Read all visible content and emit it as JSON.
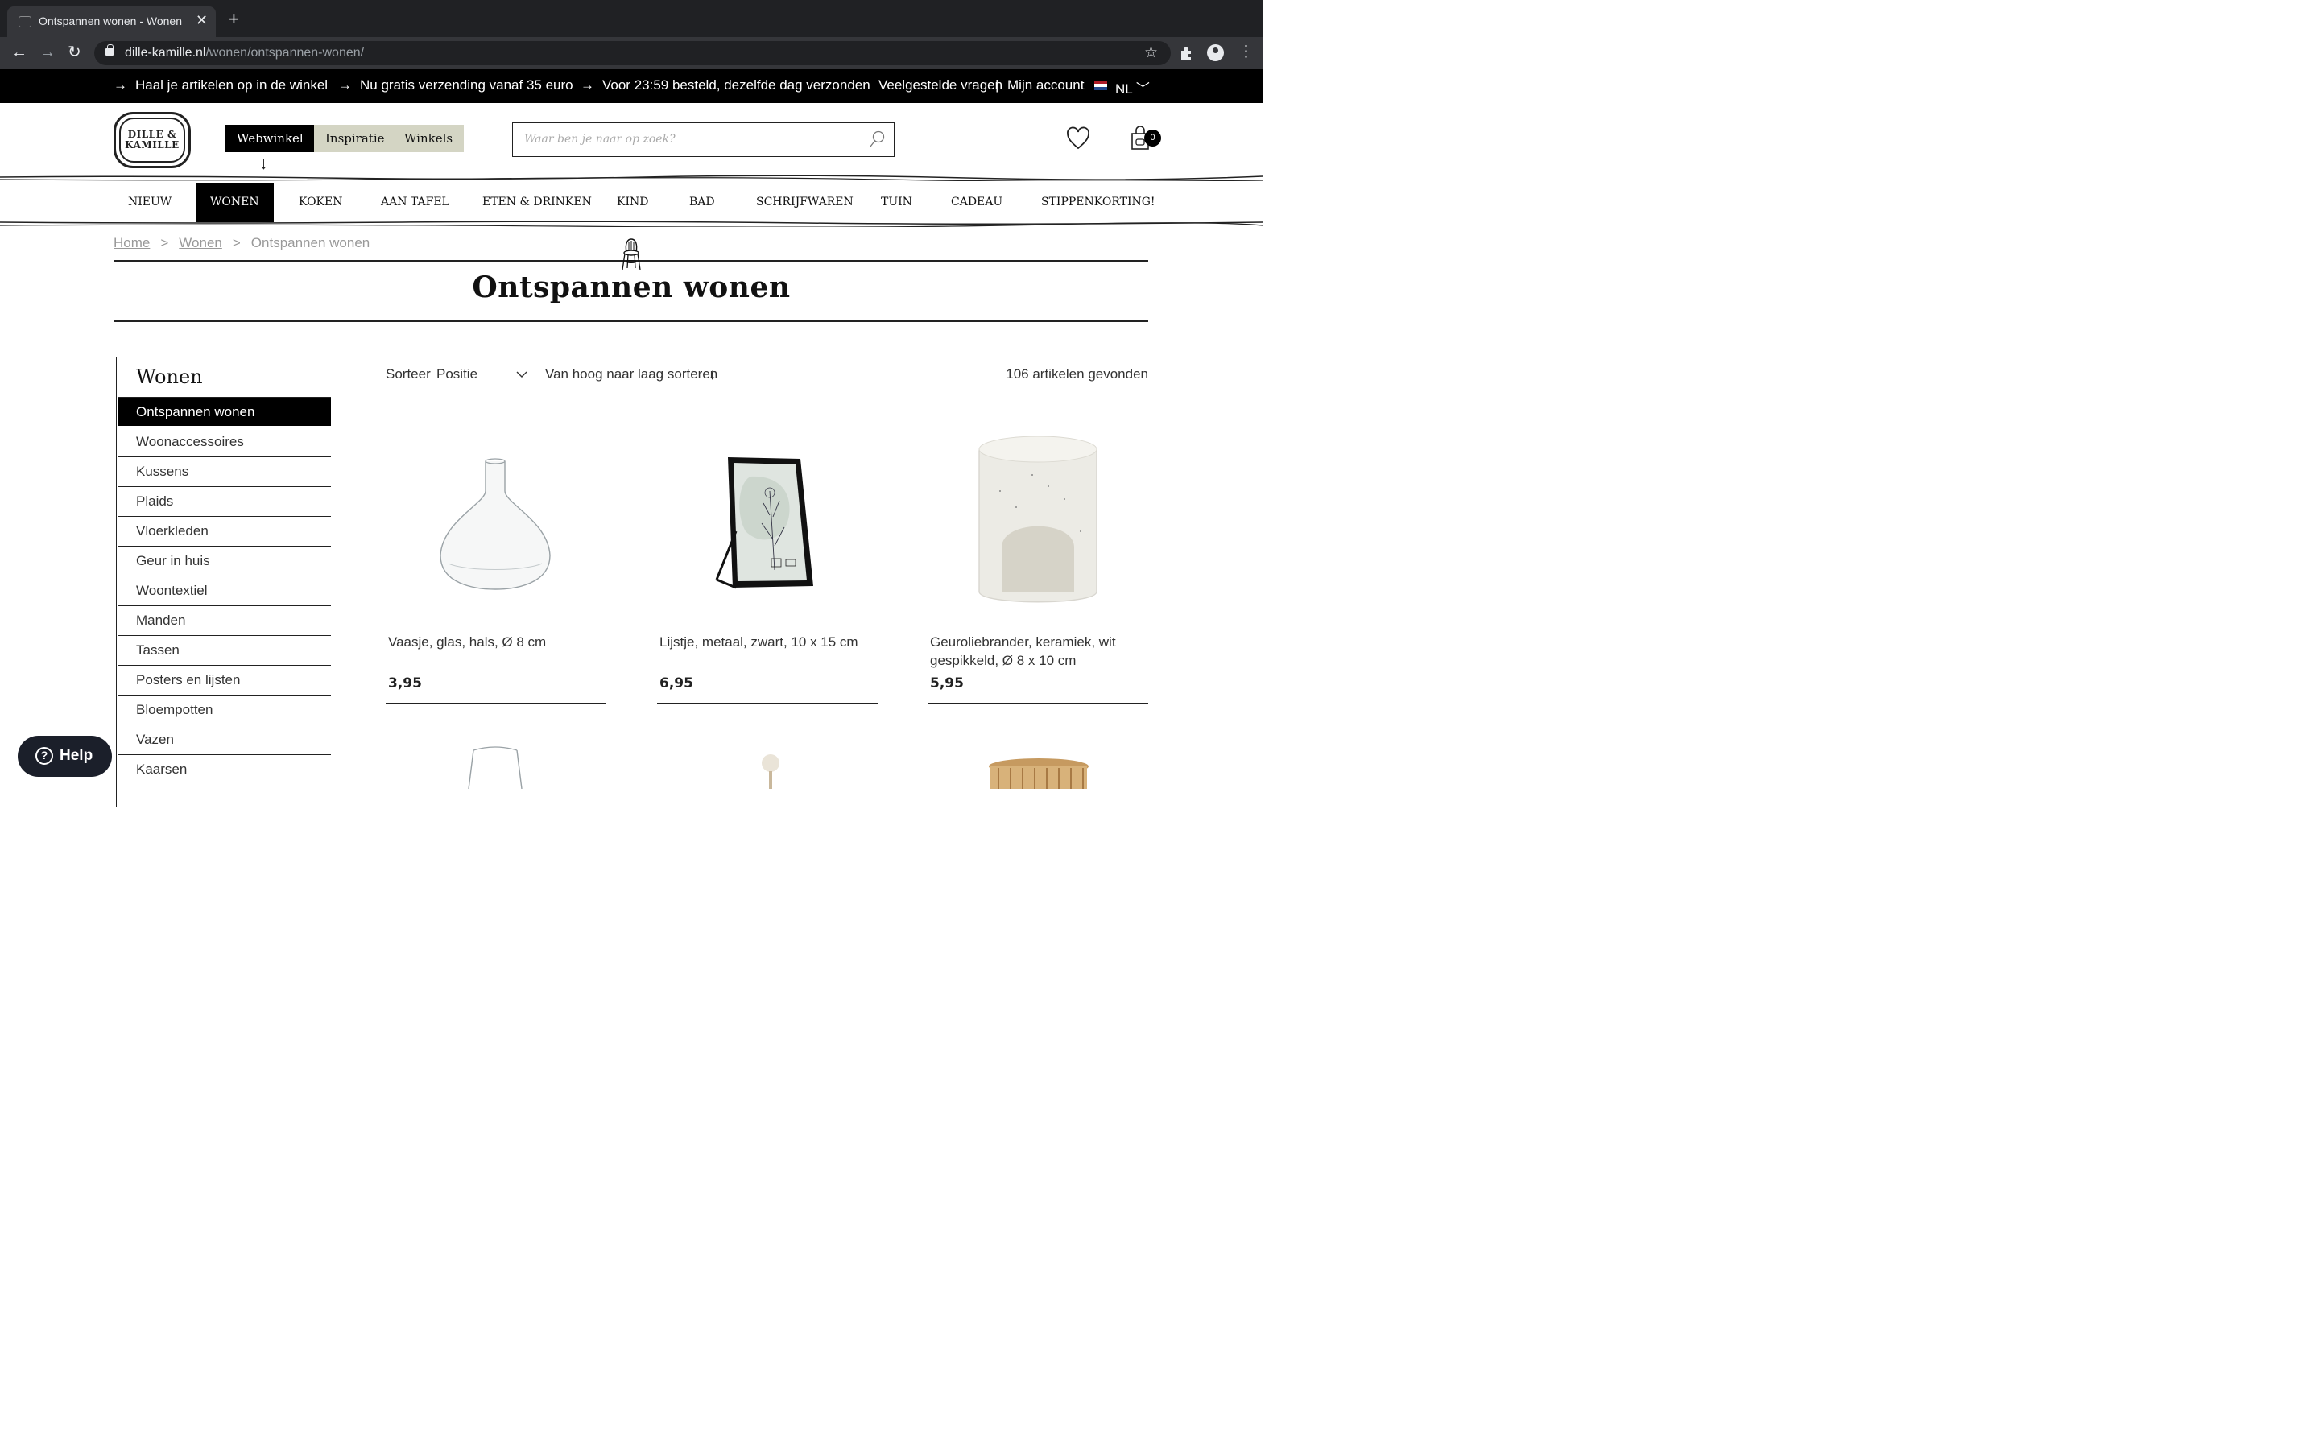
{
  "browser": {
    "tab_title": "Ontspannen wonen - Wonen",
    "url_host": "dille-kamille.nl",
    "url_path": "/wonen/ontspannen-wonen/"
  },
  "promo": {
    "items": [
      "Haal je artikelen op in de winkel",
      "Nu gratis verzending vanaf 35 euro",
      "Voor 23:59 besteld, dezelfde dag verzonden"
    ],
    "faq": "Veelgestelde vragen",
    "separator": "|",
    "account": "Mijn account",
    "language": "NL",
    "flag_colors": [
      "#ae1c28",
      "#ffffff",
      "#21468b"
    ]
  },
  "header": {
    "logo_line1": "DILLE &",
    "logo_line2": "KAMILLE",
    "pills": [
      "Webwinkel",
      "Inspiratie",
      "Winkels"
    ],
    "search_placeholder": "Waar ben je naar op zoek?",
    "cart_count": "0"
  },
  "catnav": [
    "NIEUW",
    "WONEN",
    "KOKEN",
    "AAN TAFEL",
    "ETEN & DRINKEN",
    "KIND",
    "BAD",
    "SCHRIJFWAREN",
    "TUIN",
    "CADEAU",
    "STIPPENKORTING!"
  ],
  "breadcrumb": {
    "home": "Home",
    "sep": ">",
    "parent": "Wonen",
    "current": "Ontspannen wonen"
  },
  "page_title": "Ontspannen wonen",
  "sidebar": {
    "title": "Wonen",
    "items": [
      "Ontspannen wonen",
      "Woonaccessoires",
      "Kussens",
      "Plaids",
      "Vloerkleden",
      "Geur in huis",
      "Woontextiel",
      "Manden",
      "Tassen",
      "Posters en lijsten",
      "Bloempotten",
      "Vazen",
      "Kaarsen"
    ]
  },
  "sort": {
    "label": "Sorteer",
    "selected": "Positie",
    "direction": "Van hoog naar laag sorteren",
    "result_count": "106 artikelen gevonden"
  },
  "products": [
    {
      "name": "Vaasje, glas, hals, Ø 8 cm",
      "price": "3,95"
    },
    {
      "name": "Lijstje, metaal, zwart, 10 x 15 cm",
      "price": "6,95"
    },
    {
      "name": "Geuroliebrander, keramiek, wit gespikkeld, Ø 8 x 10 cm",
      "price": "5,95"
    }
  ],
  "help": {
    "label": "Help"
  },
  "accent_colors": {
    "pill_inactive": "#d4d5c4",
    "black": "#000000"
  }
}
